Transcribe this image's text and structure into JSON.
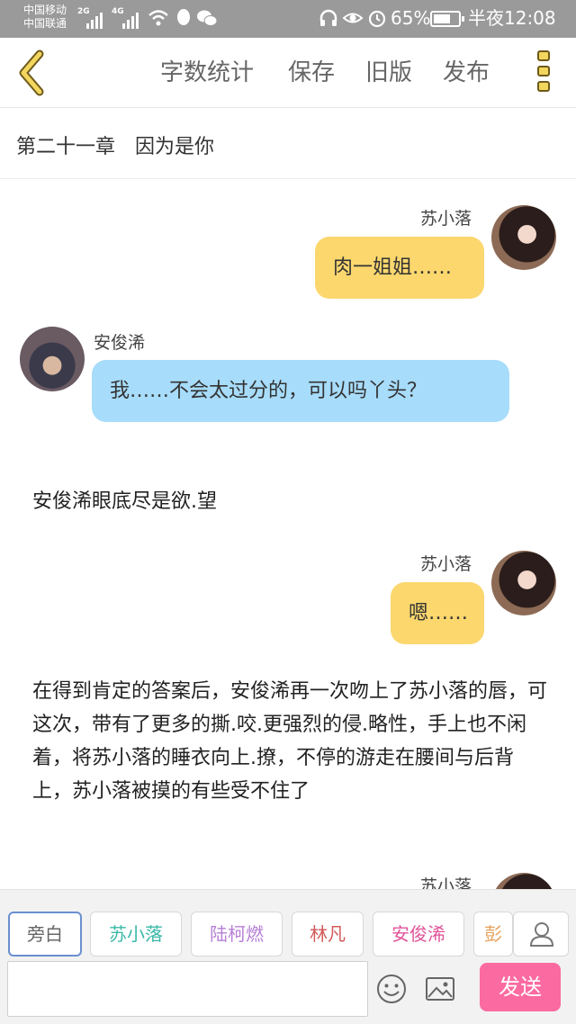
{
  "status_bar": {
    "carrier_1": "中国移动",
    "carrier_2": "中国联通",
    "net_1": "2G",
    "net_2": "4G",
    "battery_text": "65%",
    "time": "半夜12:08"
  },
  "toolbar": {
    "word_count_label": "字数统计",
    "save_label": "保存",
    "old_version_label": "旧版",
    "publish_label": "发布"
  },
  "chapter": {
    "title": "第二十一章　因为是你"
  },
  "messages": [
    {
      "speaker": "苏小落",
      "text": "肉一姐姐……"
    },
    {
      "speaker": "安俊浠",
      "text": "我……不会太过分的，可以吗丫头？"
    },
    {
      "narration": "安俊浠眼底尽是欲.望"
    },
    {
      "speaker": "苏小落",
      "text": "嗯……"
    },
    {
      "narration": "在得到肯定的答案后，安俊浠再一次吻上了苏小落的唇，可这次，带有了更多的撕.咬.更强烈的侵.略性，手上也不闲着，将苏小落的睡衣向上.撩，不停的游走在腰间与后背上，苏小落被摸的有些受不住了"
    },
    {
      "speaker": "苏小落"
    }
  ],
  "roles": [
    {
      "label": "旁白",
      "color": "#666666"
    },
    {
      "label": "苏小落",
      "color": "#3bb8a8"
    },
    {
      "label": "陆柯燃",
      "color": "#b77fd6"
    },
    {
      "label": "林凡",
      "color": "#d45a5a"
    },
    {
      "label": "安俊浠",
      "color": "#e0549a"
    },
    {
      "label": "彭",
      "color": "#e6a15a"
    }
  ],
  "composer": {
    "input_value": "",
    "send_label": "发送"
  },
  "colors": {
    "accent_yellow": "#f3d65e",
    "bubble_yellow": "#fbd76e",
    "bubble_blue": "#a7dcfa",
    "send_pink": "#fb6aa0"
  }
}
